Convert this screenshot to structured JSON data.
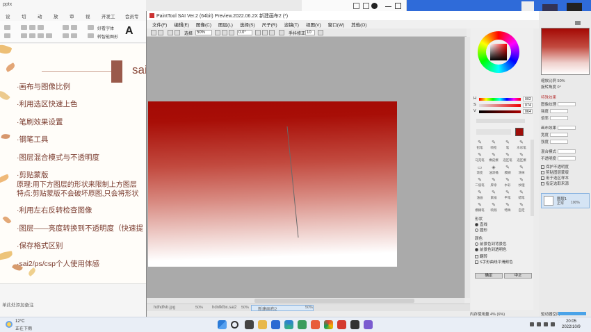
{
  "ppt": {
    "title": "pptx",
    "tabs": [
      "设计",
      "切换",
      "动画",
      "放映",
      "审阅",
      "视图",
      "开发工具",
      "会员专享"
    ],
    "font_label": "好看字体",
    "font_label2": "转智能图形",
    "big_a": "A",
    "slide": {
      "heading_partial": "sai",
      "items": [
        "·画布与图像比例",
        "·利用选区快速上色",
        "·笔刷效果设置",
        "·钢笔工具",
        "·图层混合模式与不透明度",
        "·剪贴蒙版",
        "·利用左右反转检查图像",
        "·图层——亮度转换到不透明度（快速提",
        "·保存格式区别",
        "·sai2/ps/csp个人使用体感"
      ],
      "sub_line_1": "原理:用下方图层的形状来限制上方图层",
      "sub_line_2": "特点:剪贴蒙版不会破坏原图,只会将形状"
    },
    "notes": "单此处添加备注"
  },
  "sai": {
    "title": "PaintTool SAI Ver.2 (64bit) Preview.2022.06.2X    新建画布2 (*)",
    "menu": [
      "文件(F)",
      "编辑(E)",
      "图像(C)",
      "图层(L)",
      "选择(S)",
      "尺子(R)",
      "滤镜(T)",
      "视图(V)",
      "窗口(W)",
      "其他(O)"
    ],
    "toolbar": {
      "select_label": "选择",
      "zoom": "50%",
      "angle": "0.0°",
      "stabilizer_label": "手抖修正",
      "stabilizer_value": "10"
    },
    "doc_tabs": [
      {
        "name": "hdhdfvb.jpg",
        "zoom": "50%"
      },
      {
        "name": "hdnfkfbx.sai2",
        "zoom": "50%"
      },
      {
        "name": "新建画布2",
        "zoom": "50%"
      }
    ],
    "status": "内存使用量 4% (6%)",
    "color": {
      "h_label": "H",
      "h_value": "002",
      "s_label": "S",
      "s_value": "074",
      "v_label": "V",
      "v_value": "064",
      "current": "#a00e0a"
    },
    "tools": [
      {
        "label": "铅笔",
        "glyph": "✎"
      },
      {
        "label": "喷枪",
        "glyph": "✎"
      },
      {
        "label": "笔",
        "glyph": "✎"
      },
      {
        "label": "水彩笔",
        "glyph": "✎"
      },
      {
        "label": "马克笔",
        "glyph": "✎"
      },
      {
        "label": "橡皮擦",
        "glyph": "✎"
      },
      {
        "label": "选区笔",
        "glyph": "✎"
      },
      {
        "label": "选区擦",
        "glyph": "✎"
      },
      {
        "label": "渐变",
        "glyph": "▭"
      },
      {
        "label": "油漆桶",
        "glyph": "◈"
      },
      {
        "label": "模糊",
        "glyph": "✎"
      },
      {
        "label": "涂抹",
        "glyph": "✎"
      },
      {
        "label": "二值笔",
        "glyph": "✎"
      },
      {
        "label": "厚涂",
        "glyph": "✎"
      },
      {
        "label": "水彩",
        "glyph": "✎"
      },
      {
        "label": "纹理",
        "glyph": "✎"
      },
      {
        "label": "油画",
        "glyph": "✎"
      },
      {
        "label": "素描",
        "glyph": "✎"
      },
      {
        "label": "平笔",
        "glyph": "✎"
      },
      {
        "label": "蜡笔",
        "glyph": "✎"
      },
      {
        "label": "模糊笔",
        "glyph": "✎"
      },
      {
        "label": "喷溅",
        "glyph": "✎"
      },
      {
        "label": "特殊",
        "glyph": "✎"
      },
      {
        "label": "自定",
        "glyph": "✎"
      }
    ],
    "options": {
      "shape_label": "形状",
      "shape_opt1": "直线",
      "shape_opt2": "圆形",
      "color_label": "颜色",
      "color_opt1": "前景色到背景色",
      "color_opt2": "前景色到透明色",
      "flip_label": "翻转",
      "srgb_label": "S字形曲线平滑颜色",
      "ok_button": "确定",
      "cancel_button": "中止"
    }
  },
  "layers": {
    "opacity_label": "缩放比例",
    "opacity_value": "50%",
    "angle_label": "旋转角度",
    "angle_value": "0°",
    "section_label": "特殊效果",
    "rows": [
      "图像纹理",
      "强度",
      "倍率",
      "画布效果",
      "宽度",
      "强度",
      "混合模式",
      "不透明度"
    ],
    "checks": [
      "保护不透明度",
      "剪贴图层蒙版",
      "用于选区样本",
      "指定选取来源"
    ],
    "layer_name": "图层1",
    "layer_mode": "正常",
    "layer_opacity": "100%",
    "memory": "驱动器空间"
  },
  "taskbar": {
    "weather_temp": "12°C",
    "weather_desc": "正在下雨",
    "time": "20:05",
    "date": "2022/10/9"
  }
}
